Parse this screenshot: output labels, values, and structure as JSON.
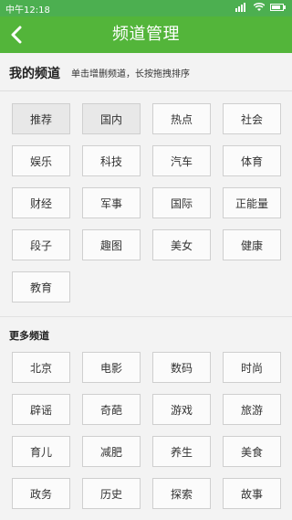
{
  "status": {
    "left": "中午12:18",
    "signal_icon": "signal-icon",
    "wifi_icon": "wifi-icon",
    "battery_icon": "battery-icon"
  },
  "appbar": {
    "title": "频道管理",
    "back_icon": "back-icon"
  },
  "my_channels": {
    "title": "我的频道",
    "subtitle": "单击增删频道，长按拖拽排序",
    "items": [
      "推荐",
      "国内",
      "热点",
      "社会",
      "娱乐",
      "科技",
      "汽车",
      "体育",
      "财经",
      "军事",
      "国际",
      "正能量",
      "段子",
      "趣图",
      "美女",
      "健康",
      "教育"
    ]
  },
  "more_channels": {
    "title": "更多频道",
    "items": [
      "北京",
      "电影",
      "数码",
      "时尚",
      "辟谣",
      "奇葩",
      "游戏",
      "旅游",
      "育儿",
      "减肥",
      "养生",
      "美食",
      "政务",
      "历史",
      "探索",
      "故事"
    ]
  },
  "colors": {
    "green": "#53b53a"
  }
}
